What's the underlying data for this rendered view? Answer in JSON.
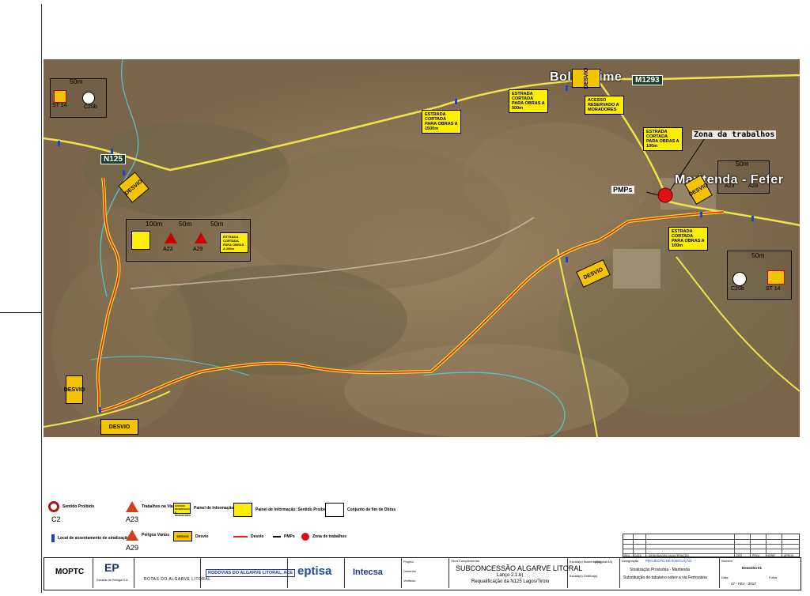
{
  "map": {
    "places": {
      "boliqueime": "Boliqueime",
      "maritenda": "Maritenda - Fefer",
      "n125": "N125",
      "m1293": "M1293"
    },
    "zone_label": "Zona da trabalhos",
    "pmps_label": "PMPs",
    "info_boxes": [
      "ESTRADA CORTADA PARA OBRAS A 1500m",
      "ESTRADA CORTADA PARA OBRAS A 500m",
      "ACESSO RESERVADO A MORADORES",
      "ESTRADA CORTADA PARA OBRAS A 100m",
      "ESTRADA CORTADA PARA OBRAS A 100m",
      "ESTRADA CORTADA PARA OBRAS A 200m"
    ],
    "desvio": "DESVIO",
    "distances": {
      "d50": "50m",
      "d100": "100m",
      "d200": "200m"
    },
    "sign_codes": {
      "st14": "ST 14",
      "c20b": "C20b",
      "a23": "A23",
      "a29": "A29"
    }
  },
  "legend": {
    "items": [
      {
        "code": "C2",
        "label": "Sentido Proibido"
      },
      {
        "code": "A23",
        "label": "Trabalhos na Via"
      },
      {
        "code": "",
        "label": "Painel de Informação"
      },
      {
        "code": "",
        "label": "Painel de Informação: Sentido Proibido"
      },
      {
        "code": "",
        "label": "Conjunto de fim de Obras"
      },
      {
        "code": "",
        "label": "Local de assentamento de sinalização"
      },
      {
        "code": "A29",
        "label": "Perigos Vários"
      },
      {
        "code": "",
        "label": "Desvio"
      },
      {
        "code": "",
        "label": "Desvio"
      },
      {
        "code": "",
        "label": "PMPs"
      },
      {
        "code": "",
        "label": "Zona de trabalhos"
      }
    ],
    "desvio_sign": "DESVIO",
    "info_panel_text": "ACESSO RESERVADO A MORADORES"
  },
  "title_block": {
    "logos": [
      "MOPTC",
      "EP",
      "ROTAS DO ALGARVE LITORAL",
      "RODOVIAS DO ALGARVE LITORAL, ACE",
      "eptisa",
      "Intecsa"
    ],
    "ep_sub": "Estradas de Portugal S.A.",
    "labels": [
      "Projeto",
      "Desenho",
      "Verificou"
    ],
    "stage": "Obra Complementar",
    "project_title": "SUBCONCESSÃO ALGARVE LITORAL",
    "lot": "Lanço 2.1.b)",
    "subtitle": "Requalificação da N125 Lagos/Tirolo",
    "scale_label": "Escala(s) Numérica(s)",
    "scale_value": "(Original A3)",
    "scale_graphic": "Escala(s) Gráfica(s)",
    "designation_label": "Designação",
    "phase": "PROJECTO DE EXECUÇÃO",
    "drawing_title_1": "Sinalização Provisória - Maritenda",
    "drawing_title_2": "Substituição do tabuleiro sobre a via Ferroviária",
    "number_label": "Número",
    "sheet_label": "Desenho",
    "sheet_value": "01",
    "date_label": "Data",
    "date_value": "27 - FEV - 2017",
    "page_label": "Folha"
  },
  "revision_table": {
    "headers": [
      "REV",
      "DATA",
      "DESIGNAÇÃO DA ALTERAÇÃO",
      "DES",
      "PROJ",
      "VERIF",
      "APROV"
    ]
  },
  "colors": {
    "route_red": "#d9261c",
    "route_yellow": "#f0e020",
    "road_yellow": "#f2e24a",
    "sign_yellow": "#ffee00",
    "pmp_red": "#e01010",
    "water_cyan": "#4fc6c9"
  }
}
